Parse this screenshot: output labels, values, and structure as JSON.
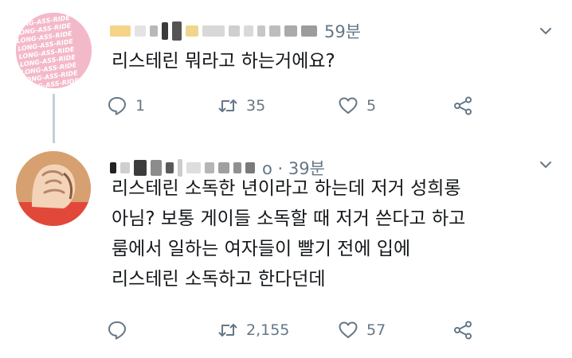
{
  "tweets": [
    {
      "avatar": "pink-text-pattern-avatar",
      "avatar_text": "A LONG-ASS-RIDE",
      "time": "59분",
      "lines": [
        "리스테린 뭐라고 하는거에요?"
      ],
      "reply_count": "1",
      "retweet_count": "35",
      "like_count": "5"
    },
    {
      "avatar": "red-figure-avatar",
      "time": "o · 39분",
      "lines": [
        "리스테린 소독한 년이라고 하는데 저거 성희롱",
        "아님? 보통 게이들 소독할 때 저거 쓴다고 하고",
        "룸에서 일하는 여자들이 빨기 전에 입에",
        "리스테린 소독하고 한다던데"
      ],
      "reply_count": "",
      "retweet_count": "2,155",
      "like_count": "57"
    }
  ],
  "icons": {
    "reply": "reply-icon",
    "retweet": "retweet-icon",
    "like": "heart-icon",
    "share": "share-icon",
    "menu": "chevron-down-icon"
  },
  "colors": {
    "icon_gray": "#657786",
    "text": "#14171a",
    "thread_line": "#c4cfd6",
    "avatar_pink": "#f3b9c9"
  }
}
